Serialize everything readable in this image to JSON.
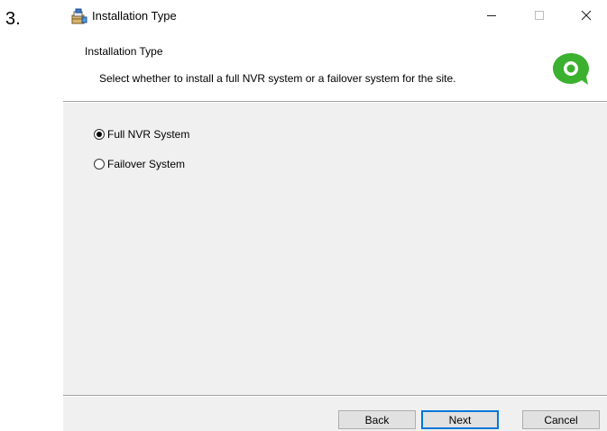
{
  "step": "3.",
  "window": {
    "title": "Installation Type",
    "controls": {
      "minimize": "minimize-icon",
      "maximize": "maximize-icon",
      "close": "close-icon"
    }
  },
  "header": {
    "title": "Installation Type",
    "description": "Select whether to install a full NVR system or a failover system for the site.",
    "logo_color": "#3cb02f"
  },
  "options": [
    {
      "label": "Full NVR System",
      "selected": true
    },
    {
      "label": "Failover System",
      "selected": false
    }
  ],
  "buttons": {
    "back": "Back",
    "next": "Next",
    "cancel": "Cancel"
  },
  "colors": {
    "accent": "#0078d7",
    "panel": "#f0f0f0"
  }
}
